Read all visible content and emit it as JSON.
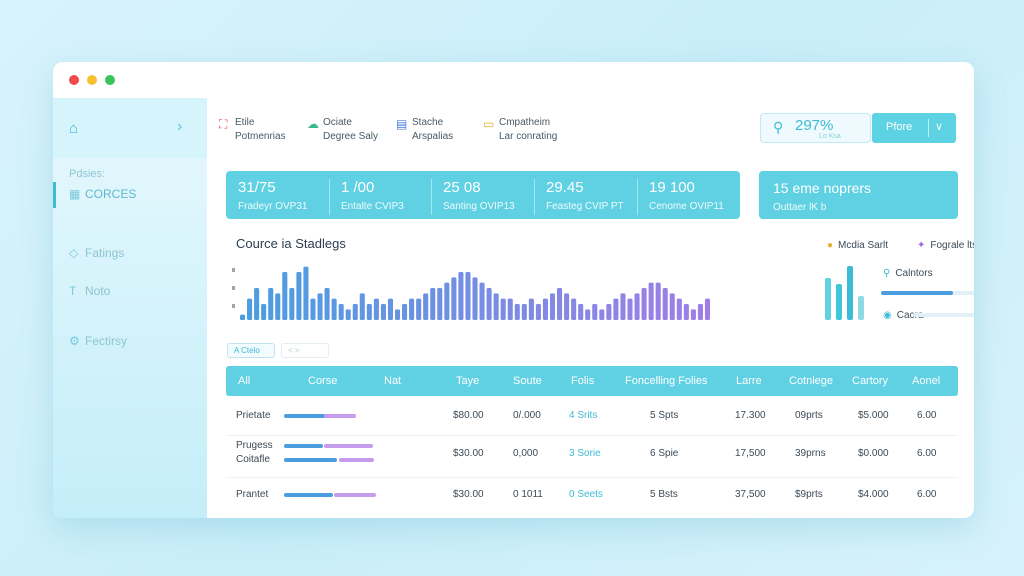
{
  "window": {
    "controls": {
      "close": "#f04a4a",
      "minimize": "#f5c033",
      "maximize": "#3cc45a"
    }
  },
  "sidebar": {
    "home_icon": "home-icon",
    "group_label": "Pdsies:",
    "items": [
      {
        "label": "CORCES",
        "icon": "grid-icon",
        "active": true
      },
      {
        "label": "Fatings",
        "icon": "tag-icon"
      },
      {
        "label": "Noto",
        "icon": "text-icon"
      },
      {
        "label": "Fectirsy",
        "icon": "settings-icon"
      }
    ]
  },
  "quick_actions": [
    {
      "line1": "Etile",
      "line2": "Potmenrias",
      "icon": "gift-icon",
      "color": "#e0505a"
    },
    {
      "line1": "Ociate",
      "line2": "Degree Saly",
      "icon": "cloud-icon",
      "color": "#3cb890"
    },
    {
      "line1": "Stache",
      "line2": "Arspalias",
      "icon": "building-icon",
      "color": "#4a7ed8"
    },
    {
      "line1": "Cmpatheim",
      "line2": "Lar conrating",
      "icon": "chat-icon",
      "color": "#e8b030"
    }
  ],
  "header": {
    "search_value": "297%",
    "search_sub": "Lo Ksa",
    "primary_button": "Pfore"
  },
  "stats": [
    {
      "value": "31/75",
      "caption": "Fradeyr OVP31"
    },
    {
      "value": "1 /00",
      "caption": "Entalte CVIP3"
    },
    {
      "value": "25 08",
      "caption": "Santing OVIP13"
    },
    {
      "value": "29.45",
      "caption": "Feasteg CVIP PT"
    },
    {
      "value": "19 100",
      "caption": "Cenome OVIP11"
    }
  ],
  "summary": {
    "title": "15 eme noprers",
    "subtitle": "Outtaer lK b"
  },
  "chart_title": "Cource ia Stadlegs",
  "chart_data": {
    "type": "bar",
    "title": "Cource ia Stadlegs",
    "ylim": [
      0,
      12
    ],
    "values": [
      1,
      4,
      6,
      3,
      6,
      5,
      9,
      6,
      9,
      10,
      4,
      5,
      6,
      4,
      3,
      2,
      3,
      5,
      3,
      4,
      3,
      4,
      2,
      3,
      4,
      4,
      5,
      6,
      6,
      7,
      8,
      9,
      9,
      8,
      7,
      6,
      5,
      4,
      4,
      3,
      3,
      4,
      3,
      4,
      5,
      6,
      5,
      4,
      3,
      2,
      3,
      2,
      3,
      4,
      5,
      4,
      5,
      6,
      7,
      7,
      6,
      5,
      4,
      3,
      2,
      3,
      4
    ],
    "colors": {
      "start": "#4a9ee0",
      "end": "#a07ee6"
    }
  },
  "legend": [
    {
      "label": "Mcdia Sarlt",
      "icon": "user-icon",
      "color": "#e8b030"
    },
    {
      "label": "Fograle lts",
      "icon": "star-icon",
      "color": "#9a66dd"
    }
  ],
  "mini_bars": [
    {
      "value": 7,
      "color": "#5fd1e3"
    },
    {
      "value": 6,
      "color": "#3fc6d8"
    },
    {
      "value": 9,
      "color": "#3bbcd6"
    },
    {
      "value": 4,
      "color": "#8fd9e6"
    }
  ],
  "progress": [
    {
      "label": "Calntors",
      "fill": 0.65,
      "color": "#4a9ee0"
    },
    {
      "label": "Cacra",
      "fill": 0.0,
      "color": "#4a9ee0"
    }
  ],
  "filters": {
    "active": "A Ctelo",
    "inactive": "< >"
  },
  "table": {
    "columns": [
      "All",
      "Corse",
      "Nat",
      "Taye",
      "Soute",
      "Folis",
      "Foncelling Folies",
      "Larre",
      "Cotnlege",
      "Cartory",
      "Aonel"
    ],
    "rows": [
      {
        "names": [
          "Prietate"
        ],
        "bars": [
          [
            0.6,
            0.45
          ]
        ],
        "taye": "$80.00",
        "soute": "0/.000",
        "folis": "4 Srits",
        "foncelling": "5 Spts",
        "larre": "17.300",
        "cotnlege": "09prts",
        "cartory": "$5.000",
        "aonel": "6.00"
      },
      {
        "names": [
          "Prugess",
          "Coitafle"
        ],
        "bars": [
          [
            0.55,
            0.7
          ],
          [
            0.75,
            0.5
          ]
        ],
        "taye": "$30.00",
        "soute": "0,000",
        "folis": "3 Sorie",
        "foncelling": "6 Spie",
        "larre": "17,500",
        "cotnlege": "39prns",
        "cartory": "$0.000",
        "aonel": "6.00"
      },
      {
        "names": [
          "Prantet"
        ],
        "bars": [
          [
            0.7,
            0.6
          ]
        ],
        "taye": "$30.00",
        "soute": "0 1011",
        "folis": "0 Seets",
        "foncelling": "5 Bsts",
        "larre": "37,500",
        "cotnlege": "$9prts",
        "cartory": "$4.000",
        "aonel": "6.00"
      }
    ]
  }
}
